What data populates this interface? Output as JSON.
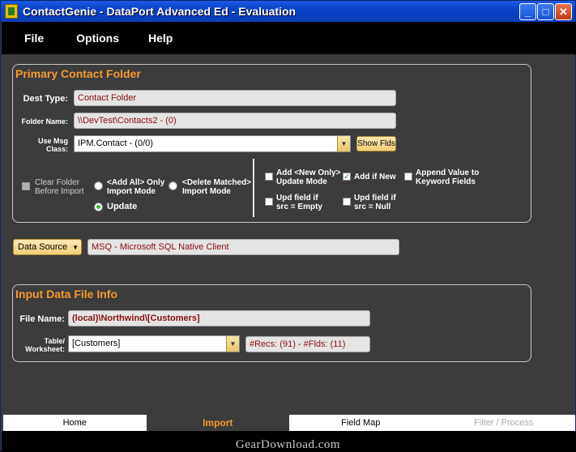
{
  "window": {
    "title": "ContactGenie - DataPort Advanced Ed - Evaluation"
  },
  "menu": {
    "file": "File",
    "options": "Options",
    "help": "Help"
  },
  "primary": {
    "title": "Primary Contact Folder",
    "dest_type_label": "Dest Type:",
    "dest_type_value": "Contact Folder",
    "folder_name_label": "Folder Name:",
    "folder_name_value": "\\\\DevTest\\Contacts2 - (0)",
    "use_msg_label_1": "Use Msg",
    "use_msg_label_2": "Class:",
    "msg_class_value": "IPM.Contact - (0/0)",
    "show_flds": "Show Flds",
    "clear_folder_1": "Clear Folder",
    "clear_folder_2": "Before Import",
    "add_all_1": "<Add All> Only",
    "add_all_2": "Import Mode",
    "delete_matched_1": "<Delete Matched>",
    "delete_matched_2": "Import Mode",
    "update": "Update",
    "add_new_1": "Add <New Only>",
    "add_new_2": "Update Mode",
    "add_if_new": "Add if New",
    "append_1": "Append Value to",
    "append_2": "Keyword Fields",
    "upd_empty_1": "Upd field if",
    "upd_empty_2": "src =  Empty",
    "upd_null_1": "Upd field if",
    "upd_null_2": "src = Null"
  },
  "data_source": {
    "button": "Data Source",
    "value": "MSQ - Microsoft SQL Native Client"
  },
  "input": {
    "title": "Input Data File Info",
    "file_name_label": "File Name:",
    "file_name_value": "(local)\\Northwind\\[Customers]",
    "table_label_1": "Table/",
    "table_label_2": "Worksheet:",
    "table_value": "[Customers]",
    "recs": "#Recs: (91) - #Flds: (11)"
  },
  "tabs": {
    "home": "Home",
    "import": "Import",
    "field_map": "Field Map",
    "filter": "Filter / Process"
  },
  "watermark": "GearDownload.com"
}
